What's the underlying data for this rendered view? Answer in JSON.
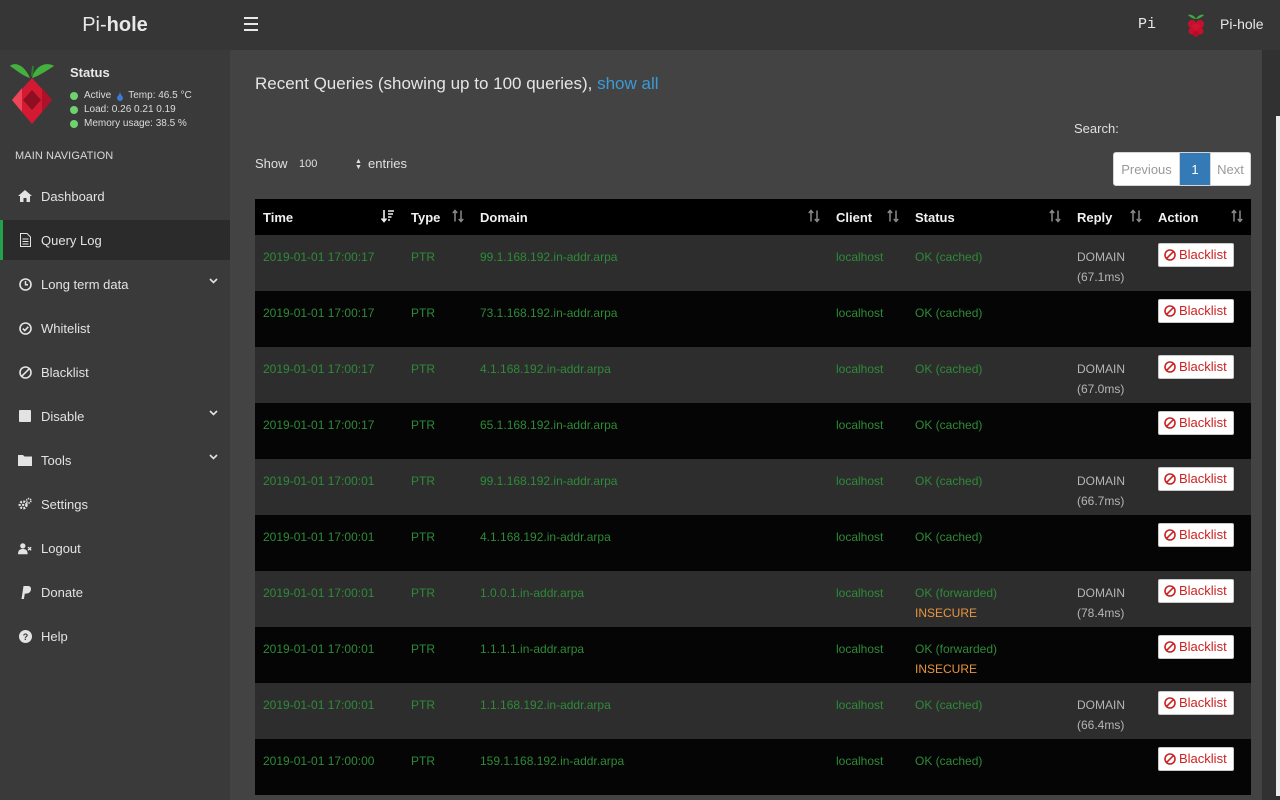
{
  "app": {
    "logo_prefix": "Pi-",
    "logo_bold": "hole",
    "hostname": "Pi",
    "user": "Pi-hole"
  },
  "status": {
    "title": "Status",
    "active": "Active",
    "temp": "Temp: 46.5 °C",
    "load": "Load:  0.26  0.21  0.19",
    "memory": "Memory usage:  38.5 %"
  },
  "nav": {
    "header": "MAIN NAVIGATION",
    "items": [
      {
        "label": "Dashboard",
        "icon": "home-icon"
      },
      {
        "label": "Query Log",
        "icon": "file-text-icon",
        "active": true
      },
      {
        "label": "Long term data",
        "icon": "clock-icon",
        "expandable": true
      },
      {
        "label": "Whitelist",
        "icon": "check-circle-icon"
      },
      {
        "label": "Blacklist",
        "icon": "ban-icon"
      },
      {
        "label": "Disable",
        "icon": "stop-icon",
        "expandable": true
      },
      {
        "label": "Tools",
        "icon": "folder-icon",
        "expandable": true
      },
      {
        "label": "Settings",
        "icon": "gears-icon"
      },
      {
        "label": "Logout",
        "icon": "user-times-icon"
      },
      {
        "label": "Donate",
        "icon": "paypal-icon"
      },
      {
        "label": "Help",
        "icon": "question-circle-icon"
      }
    ]
  },
  "page": {
    "title": "Recent Queries (showing up to 100 queries),",
    "show_all": "show all",
    "search_label": "Search:",
    "search_value": "",
    "show_label": "Show",
    "page_length": "100",
    "entries_label": "entries",
    "pagination": {
      "previous": "Previous",
      "current": "1",
      "next": "Next"
    }
  },
  "table": {
    "columns": [
      "Time",
      "Type",
      "Domain",
      "Client",
      "Status",
      "Reply",
      "Action"
    ],
    "action_label": "Blacklist",
    "rows": [
      {
        "time": "2019-01-01 17:00:17",
        "type": "PTR",
        "domain": "99.1.168.192.in-addr.arpa",
        "client": "localhost",
        "status": "OK (cached)",
        "insecure": "",
        "reply": "DOMAIN (67.1ms)"
      },
      {
        "time": "2019-01-01 17:00:17",
        "type": "PTR",
        "domain": "73.1.168.192.in-addr.arpa",
        "client": "localhost",
        "status": "OK (cached)",
        "insecure": "",
        "reply": ""
      },
      {
        "time": "2019-01-01 17:00:17",
        "type": "PTR",
        "domain": "4.1.168.192.in-addr.arpa",
        "client": "localhost",
        "status": "OK (cached)",
        "insecure": "",
        "reply": "DOMAIN (67.0ms)"
      },
      {
        "time": "2019-01-01 17:00:17",
        "type": "PTR",
        "domain": "65.1.168.192.in-addr.arpa",
        "client": "localhost",
        "status": "OK (cached)",
        "insecure": "",
        "reply": ""
      },
      {
        "time": "2019-01-01 17:00:01",
        "type": "PTR",
        "domain": "99.1.168.192.in-addr.arpa",
        "client": "localhost",
        "status": "OK (cached)",
        "insecure": "",
        "reply": "DOMAIN (66.7ms)"
      },
      {
        "time": "2019-01-01 17:00:01",
        "type": "PTR",
        "domain": "4.1.168.192.in-addr.arpa",
        "client": "localhost",
        "status": "OK (cached)",
        "insecure": "",
        "reply": ""
      },
      {
        "time": "2019-01-01 17:00:01",
        "type": "PTR",
        "domain": "1.0.0.1.in-addr.arpa",
        "client": "localhost",
        "status": "OK (forwarded)",
        "insecure": "INSECURE",
        "reply": "DOMAIN (78.4ms)"
      },
      {
        "time": "2019-01-01 17:00:01",
        "type": "PTR",
        "domain": "1.1.1.1.in-addr.arpa",
        "client": "localhost",
        "status": "OK (forwarded)",
        "insecure": "INSECURE",
        "reply": ""
      },
      {
        "time": "2019-01-01 17:00:01",
        "type": "PTR",
        "domain": "1.1.168.192.in-addr.arpa",
        "client": "localhost",
        "status": "OK (cached)",
        "insecure": "",
        "reply": "DOMAIN (66.4ms)"
      },
      {
        "time": "2019-01-01 17:00:00",
        "type": "PTR",
        "domain": "159.1.168.192.in-addr.arpa",
        "client": "localhost",
        "status": "OK (cached)",
        "insecure": "",
        "reply": ""
      }
    ]
  },
  "colors": {
    "accent_green": "#22a04b",
    "status_dot": "#6ed36e",
    "row_text": "#2e8b37",
    "insecure": "#e8943f",
    "link": "#3c9bd6",
    "blacklist_red": "#cc2222",
    "pagination_active": "#337ab7"
  }
}
